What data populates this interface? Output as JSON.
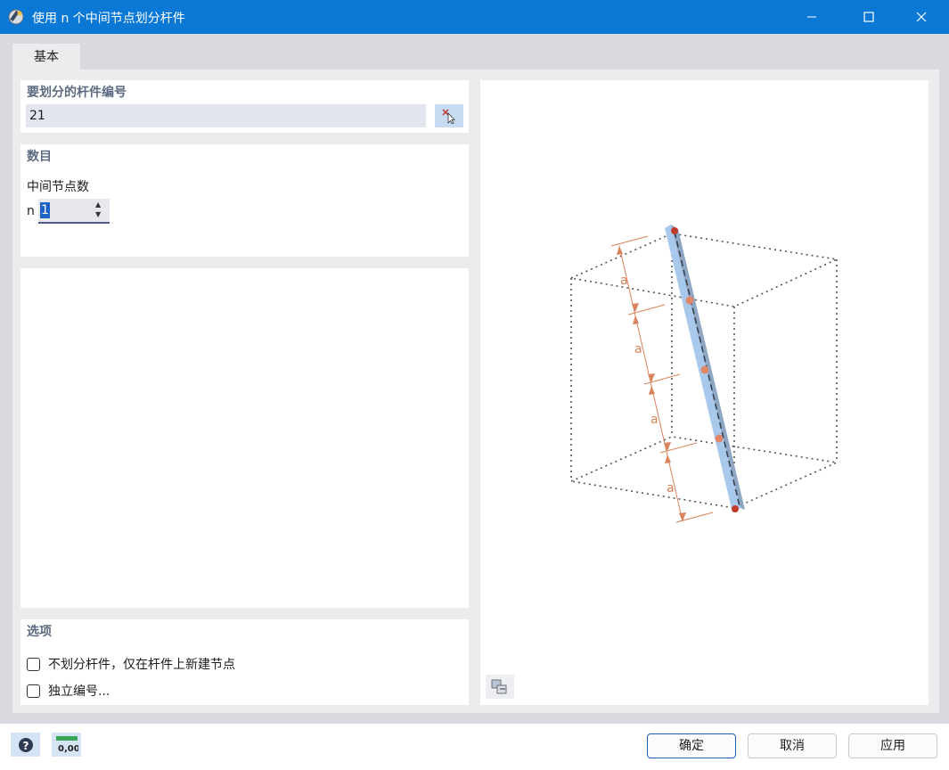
{
  "window": {
    "title": "使用 n 个中间节点划分杆件",
    "controls": [
      "minimize",
      "maximize",
      "close"
    ]
  },
  "tabs": [
    {
      "label": "基本",
      "active": true
    }
  ],
  "member_section": {
    "title": "要划分的杆件编号",
    "value": "21"
  },
  "count_section": {
    "title": "数目",
    "subtitle": "中间节点数",
    "symbol": "n",
    "value": "1"
  },
  "options_section": {
    "title": "选项",
    "checkboxes": [
      {
        "label": "不划分杆件，仅在杆件上新建节点",
        "checked": false
      },
      {
        "label": "独立编号...",
        "checked": false
      }
    ]
  },
  "preview": {
    "dim_label": "a",
    "colors": {
      "beam": "#a8c8ec",
      "dimension": "#d9825b",
      "end_node": "#c0392b",
      "mid_node": "#e0876a"
    }
  },
  "bottom": {
    "units_label": "0,00",
    "buttons": {
      "ok": "确定",
      "cancel": "取消",
      "apply": "应用"
    }
  }
}
